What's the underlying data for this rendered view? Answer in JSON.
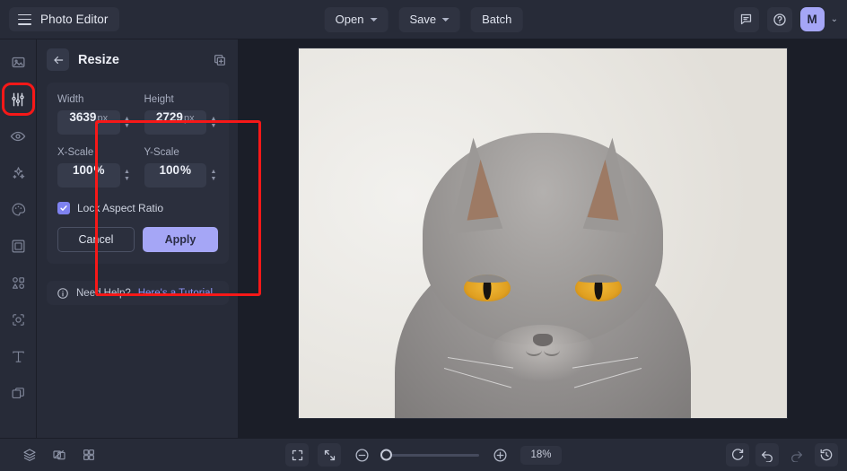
{
  "app": {
    "title": "Photo Editor",
    "accent_color": "#a5a6f6",
    "annotation_color": "#f71818",
    "panel_bg": "#272b38",
    "canvas_bg": "#1b1e28"
  },
  "topbar": {
    "menu_icon": "hamburger-icon",
    "buttons": [
      {
        "label": "Open",
        "has_caret": true
      },
      {
        "label": "Save",
        "has_caret": true
      },
      {
        "label": "Batch",
        "has_caret": false
      }
    ],
    "feedback_icon": "comment-icon",
    "help_icon": "question-circle-icon",
    "avatar_initial": "M",
    "avatar_caret": "⌄"
  },
  "rail": {
    "items": [
      {
        "name": "image",
        "icon": "image-icon",
        "active": false
      },
      {
        "name": "adjust",
        "icon": "sliders-icon",
        "active": true
      },
      {
        "name": "effects-view",
        "icon": "eye-icon",
        "active": false
      },
      {
        "name": "enhance",
        "icon": "sparkles-icon",
        "active": false
      },
      {
        "name": "color",
        "icon": "palette-icon",
        "active": false
      },
      {
        "name": "frame",
        "icon": "frame-icon",
        "active": false
      },
      {
        "name": "shapes",
        "icon": "shapes-icon",
        "active": false
      },
      {
        "name": "retouch",
        "icon": "retouch-icon",
        "active": false
      },
      {
        "name": "text",
        "icon": "text-t-icon",
        "active": false
      },
      {
        "name": "layers-panel",
        "icon": "layers-stack-icon",
        "active": false
      }
    ]
  },
  "panel": {
    "back_icon": "arrow-left-icon",
    "title": "Resize",
    "copy_icon": "duplicate-icon",
    "fields": [
      {
        "label": "Width",
        "value": "3639",
        "unit": "px"
      },
      {
        "label": "Height",
        "value": "2729",
        "unit": "px"
      },
      {
        "label": "X-Scale",
        "value": "100",
        "unit": "%"
      },
      {
        "label": "Y-Scale",
        "value": "100",
        "unit": "%"
      }
    ],
    "lock_aspect": {
      "label": "Lock Aspect Ratio",
      "checked": true,
      "check_glyph": "✓"
    },
    "cancel_label": "Cancel",
    "apply_label": "Apply",
    "help": {
      "icon": "info-circle-icon",
      "text": "Need Help?",
      "link": "Here's a Tutorial"
    }
  },
  "canvas": {
    "image_alt": "grey british shorthair cat portrait",
    "fur_color": "#9b9896",
    "eye_color": "#e0a021",
    "background_color": "#eceae5"
  },
  "bottombar": {
    "left_icons": [
      {
        "name": "layers-icon"
      },
      {
        "name": "compare-icon"
      },
      {
        "name": "grid-icon"
      }
    ],
    "fullscreen_icon": "fullscreen-icon",
    "fit-screen_icon": "fit-screen-icon",
    "zoom_out_icon": "zoom-out-icon",
    "zoom_in_icon": "zoom-in-icon",
    "zoom_value": "18%",
    "zoom_slider_percent": 2,
    "right_icons": [
      {
        "name": "reset-rotate-icon",
        "disabled": false
      },
      {
        "name": "undo-icon",
        "disabled": false
      },
      {
        "name": "redo-icon",
        "disabled": true
      },
      {
        "name": "history-icon",
        "disabled": false
      }
    ]
  }
}
